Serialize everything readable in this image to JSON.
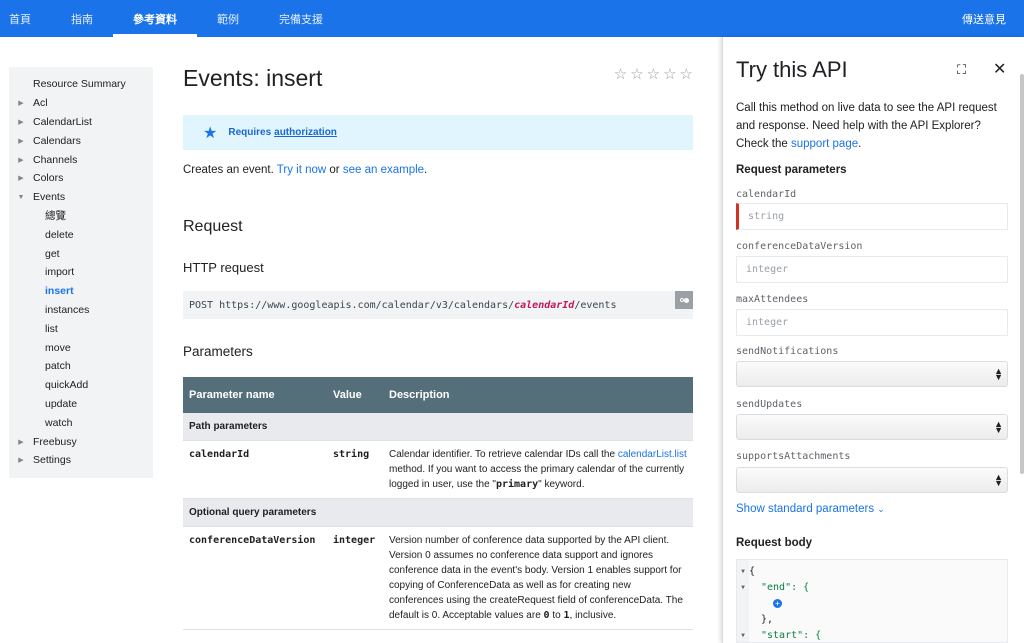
{
  "topnav": {
    "tabs": [
      "首頁",
      "指南",
      "參考資料",
      "範例",
      "完備支援"
    ],
    "active_tab": "參考資料",
    "feedback": "傳送意見"
  },
  "sidebar": {
    "items": [
      {
        "label": "Resource Summary"
      },
      {
        "label": "Acl"
      },
      {
        "label": "CalendarList"
      },
      {
        "label": "Calendars"
      },
      {
        "label": "Channels"
      },
      {
        "label": "Colors"
      },
      {
        "label": "Events"
      },
      {
        "label": "總覽"
      },
      {
        "label": "delete"
      },
      {
        "label": "get"
      },
      {
        "label": "import"
      },
      {
        "label": "insert"
      },
      {
        "label": "instances"
      },
      {
        "label": "list"
      },
      {
        "label": "move"
      },
      {
        "label": "patch"
      },
      {
        "label": "quickAdd"
      },
      {
        "label": "update"
      },
      {
        "label": "watch"
      },
      {
        "label": "Freebusy"
      },
      {
        "label": "Settings"
      }
    ],
    "selected": "insert"
  },
  "main": {
    "title": "Events: insert",
    "auth": {
      "prefix": "Requires",
      "link": "authorization"
    },
    "desc": {
      "before": "Creates an event.",
      "try_link": "Try it now",
      "mid": "or",
      "example_link": "see an example",
      "end": "."
    },
    "request_heading": "Request",
    "http_heading": "HTTP request",
    "http": {
      "prefix": "POST https://www.googleapis.com/calendar/v3/calendars/",
      "var": "calendarId",
      "suffix": "/events"
    },
    "params_heading": "Parameters",
    "table": {
      "headers": [
        "Parameter name",
        "Value",
        "Description"
      ],
      "path_section": "Path parameters",
      "row1": {
        "name": "calendarId",
        "value": "string",
        "desc_a": "Calendar identifier. To retrieve calendar IDs call the",
        "desc_link": "calendarList.list",
        "desc_b": "method. If you want to access the primary calendar of the currently logged in user, use the \"",
        "desc_code": "primary",
        "desc_c": "\" keyword."
      },
      "optional_section": "Optional query parameters",
      "row2": {
        "name": "conferenceDataVersion",
        "value": "integer",
        "desc_a": "Version number of conference data supported by the API client. Version 0 assumes no conference data support and ignores conference data in the event's body. Version 1 enables support for copying of ConferenceData as well as for creating new conferences using the createRequest field of conferenceData. The default is 0. Acceptable values are",
        "code0": "0",
        "to": "to",
        "code1": "1",
        "end": ", inclusive."
      }
    }
  },
  "panel": {
    "title": "Try this API",
    "desc_a": "Call this method on live data to see the API request and response. Need help with the API Explorer? Check the",
    "support_link": "support page",
    "desc_end": ".",
    "req_params_heading": "Request parameters",
    "fields": [
      {
        "label": "calendarId",
        "placeholder": "string"
      },
      {
        "label": "conferenceDataVersion",
        "placeholder": "integer"
      },
      {
        "label": "maxAttendees",
        "placeholder": "integer"
      },
      {
        "label": "sendNotifications"
      },
      {
        "label": "sendUpdates"
      },
      {
        "label": "supportsAttachments"
      }
    ],
    "show_standard": "Show standard parameters",
    "request_body_heading": "Request body",
    "body_lines": [
      "{",
      "\"end\": {",
      "},",
      "\"start\": {"
    ]
  }
}
